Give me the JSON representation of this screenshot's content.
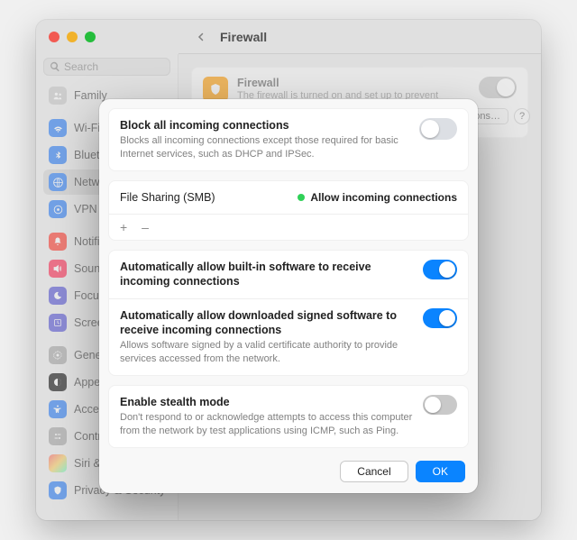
{
  "window": {
    "search_placeholder": "Search"
  },
  "sidebar": {
    "family": "Family",
    "items": [
      {
        "label": "Wi-Fi"
      },
      {
        "label": "Bluetooth"
      },
      {
        "label": "Network"
      },
      {
        "label": "VPN"
      },
      {
        "label": "Notifications"
      },
      {
        "label": "Sound"
      },
      {
        "label": "Focus"
      },
      {
        "label": "Screen Time"
      },
      {
        "label": "General"
      },
      {
        "label": "Appearance"
      },
      {
        "label": "Accessibility"
      },
      {
        "label": "Control Center"
      },
      {
        "label": "Siri & Spotlight"
      },
      {
        "label": "Privacy & Security"
      }
    ]
  },
  "header": {
    "title": "Firewall",
    "options_btn": "Options…",
    "help": "?"
  },
  "firewall_box": {
    "title": "Firewall",
    "desc": "The firewall is turned on and set up to prevent unauthorized applications, programs, and services from accepting incoming"
  },
  "dialog": {
    "block_all": {
      "title": "Block all incoming connections",
      "desc": "Blocks all incoming connections except those required for basic Internet services, such as DHCP and IPSec."
    },
    "file_sharing": {
      "name": "File Sharing (SMB)",
      "status": "Allow incoming connections"
    },
    "addrem": "+  –",
    "auto_builtin": {
      "title": "Automatically allow built-in software to receive incoming connections"
    },
    "auto_signed": {
      "title": "Automatically allow downloaded signed software to receive incoming connections",
      "desc": "Allows software signed by a valid certificate authority to provide services accessed from the network."
    },
    "stealth": {
      "title": "Enable stealth mode",
      "desc": "Don't respond to or acknowledge attempts to access this computer from the network by test applications using ICMP, such as Ping."
    },
    "cancel": "Cancel",
    "ok": "OK"
  }
}
